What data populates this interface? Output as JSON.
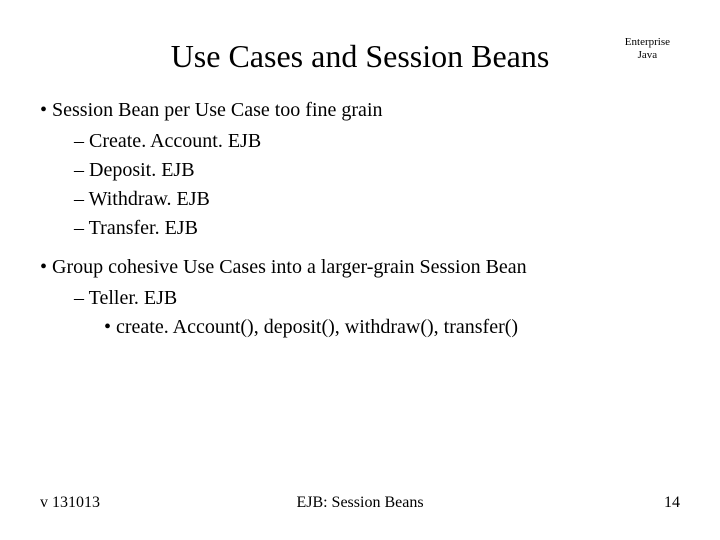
{
  "header": {
    "title": "Use Cases and Session Beans",
    "corner": "Enterprise\nJava"
  },
  "bullets": [
    {
      "text": "Session Bean per Use Case too fine grain",
      "children": [
        {
          "text": "Create. Account. EJB"
        },
        {
          "text": "Deposit. EJB"
        },
        {
          "text": "Withdraw. EJB"
        },
        {
          "text": "Transfer. EJB"
        }
      ]
    },
    {
      "text": "Group cohesive Use Cases into a larger-grain Session Bean",
      "children": [
        {
          "text": "Teller. EJB",
          "children": [
            {
              "text": "create. Account(), deposit(), withdraw(), transfer()"
            }
          ]
        }
      ]
    }
  ],
  "footer": {
    "left": "v 131013",
    "center": "EJB: Session Beans",
    "right": "14"
  }
}
